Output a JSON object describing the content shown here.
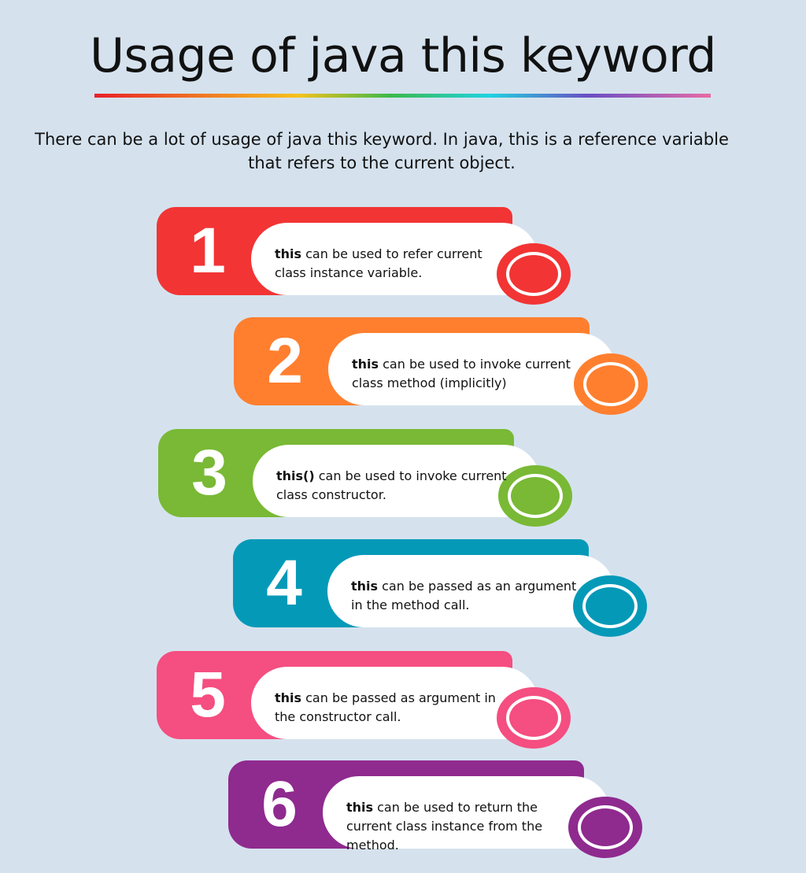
{
  "title": "Usage of java this keyword",
  "intro": "There can be a lot of usage of java this keyword. In java, this is a reference variable that refers to the current object.",
  "steps": [
    {
      "number": "1",
      "keyword": "this",
      "text": " can be used to refer current class instance variable.",
      "color": "#f23434",
      "dark": "#b8151b"
    },
    {
      "number": "2",
      "keyword": "this",
      "text": " can be used to invoke current class method (implicitly)",
      "color": "#ff7f2f",
      "dark": "#e0561c"
    },
    {
      "number": "3",
      "keyword": "this()",
      "text": " can be used to invoke current class constructor.",
      "color": "#79b935",
      "dark": "#5a8f23"
    },
    {
      "number": "4",
      "keyword": "this",
      "text": " can be passed as an argument in the method call.",
      "color": "#0599b8",
      "dark": "#037a93"
    },
    {
      "number": "5",
      "keyword": "this",
      "text": " can be passed as argument in the constructor call.",
      "color": "#f54e80",
      "dark": "#b3127f"
    },
    {
      "number": "6",
      "keyword": "this",
      "text": " can be used to return the current class instance from the method.",
      "color": "#8f2a8f",
      "dark": "#6d1870"
    }
  ]
}
